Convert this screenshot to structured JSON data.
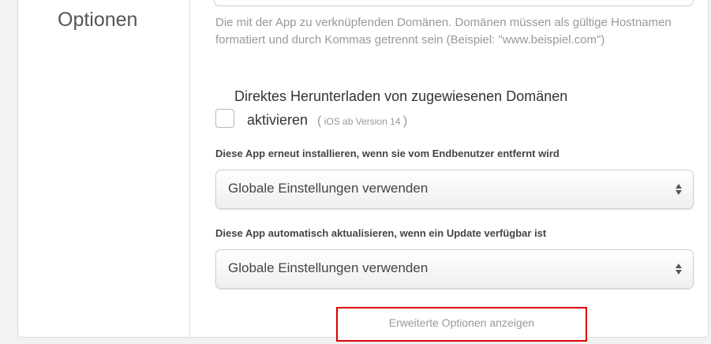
{
  "section": {
    "title": "Optionen"
  },
  "domains": {
    "help_text": "Die mit der App zu verknüpfenden Domänen. Domänen müssen als gültige Hostnamen formatiert und durch Kommas getrennt sein (Beispiel: \"www.beispiel.com\")"
  },
  "direct_download": {
    "label_line1": "Direktes Herunterladen von zugewiesenen Domänen",
    "label_line2": "aktivieren",
    "paren_open": "(",
    "note": "iOS ab Version 14",
    "paren_close": ")",
    "checked": false
  },
  "reinstall": {
    "label": "Diese App erneut installieren, wenn sie vom Endbenutzer entfernt wird",
    "selected": "Globale Einstellungen verwenden"
  },
  "auto_update": {
    "label": "Diese App automatisch aktualisieren, wenn ein Update verfügbar ist",
    "selected": "Globale Einstellungen verwenden"
  },
  "advanced": {
    "label": "Erweiterte Optionen anzeigen"
  },
  "colors": {
    "highlight_border": "#e00000",
    "muted_text": "#999999"
  }
}
